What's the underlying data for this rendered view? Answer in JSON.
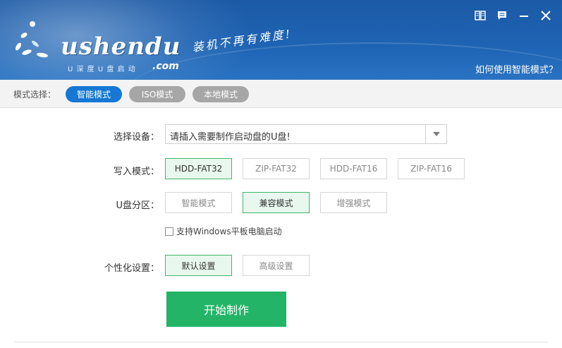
{
  "header": {
    "logo_text": "ushendu",
    "logo_sub": "U 深 度 U 盘 启 动",
    "logo_com": ".com",
    "slogan": "装机不再有难度!",
    "help_link": "如何使用智能模式？",
    "icons": [
      "book-icon",
      "message-icon",
      "minimize-icon",
      "close-icon"
    ]
  },
  "modebar": {
    "label": "模式选择：",
    "modes": [
      {
        "label": "智能模式",
        "active": true
      },
      {
        "label": "ISO模式",
        "active": false
      },
      {
        "label": "本地模式",
        "active": false
      }
    ]
  },
  "form": {
    "device": {
      "label": "选择设备：",
      "value": "请插入需要制作启动盘的U盘!"
    },
    "write_mode": {
      "label": "写入模式：",
      "options": [
        "HDD-FAT32",
        "ZIP-FAT32",
        "HDD-FAT16",
        "ZIP-FAT16"
      ],
      "selected": "HDD-FAT32"
    },
    "partition": {
      "label": "U盘分区：",
      "options": [
        "智能模式",
        "兼容模式",
        "增强模式"
      ],
      "selected": "兼容模式"
    },
    "tablet_checkbox": {
      "label": "支持Windows平板电脑启动",
      "checked": false
    },
    "personalize": {
      "label": "个性化设置：",
      "options": [
        "默认设置",
        "高级设置"
      ],
      "selected": "默认设置"
    },
    "start_button": "开始制作"
  },
  "colors": {
    "header_blue": "#1e63b3",
    "active_pill": "#1478d4",
    "inactive_pill": "#a6a6a6",
    "start_green": "#23b467",
    "selected_border": "#40b56b"
  }
}
